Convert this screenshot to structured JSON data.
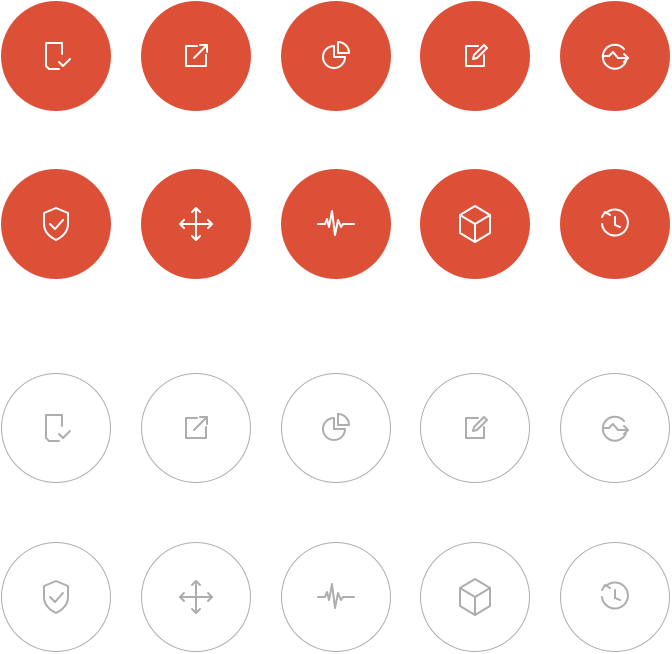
{
  "colors": {
    "accent": "#DC5038",
    "outline": "#ADADAD",
    "background": "#FFFFFF"
  },
  "icon_sets": [
    {
      "style": "filled",
      "rows": [
        [
          "document-check-icon",
          "external-link-icon",
          "pie-chart-icon",
          "edit-square-icon",
          "transfer-arrow-icon"
        ],
        [
          "shield-check-icon",
          "move-arrows-icon",
          "pulse-wave-icon",
          "cube-icon",
          "history-clock-icon"
        ]
      ]
    },
    {
      "style": "outline",
      "rows": [
        [
          "document-check-icon",
          "external-link-icon",
          "pie-chart-icon",
          "edit-square-icon",
          "transfer-arrow-icon"
        ],
        [
          "shield-check-icon",
          "move-arrows-icon",
          "pulse-wave-icon",
          "cube-icon",
          "history-clock-icon"
        ]
      ]
    }
  ]
}
